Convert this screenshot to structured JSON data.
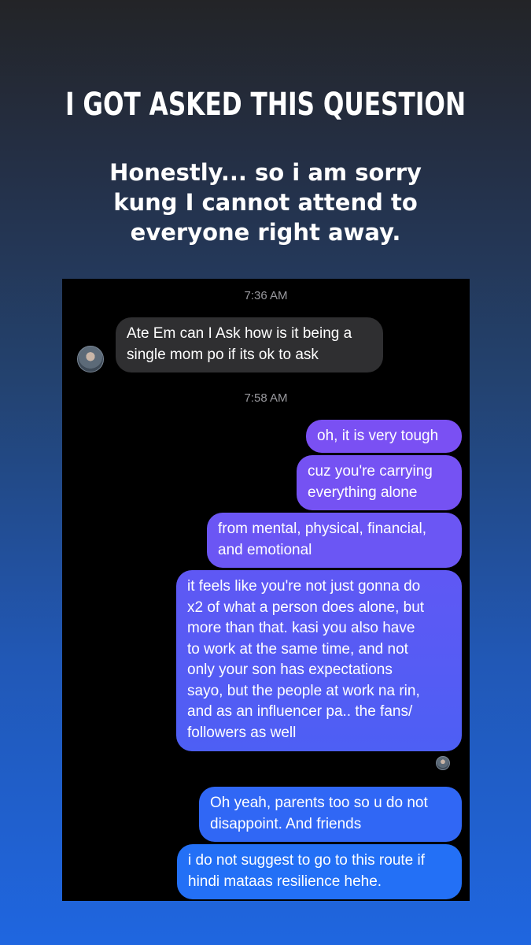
{
  "headline": "I GOT ASKED THIS QUESTION",
  "subtitle": [
    "Honestly... so i am sorry",
    "kung I cannot attend to",
    "everyone right away."
  ],
  "chat": {
    "time1": "7:36 AM",
    "incoming": [
      "Ate Em can I Ask how is it being a",
      "single mom po if its ok to ask"
    ],
    "time2": "7:58 AM",
    "outgoing1": [
      "oh, it is very tough"
    ],
    "outgoing2": [
      "cuz you're carrying",
      "everything alone"
    ],
    "outgoing3": [
      "from mental, physical, financial,",
      "and emotional"
    ],
    "outgoing4": [
      "it feels like you're not just gonna do",
      "x2 of what a person does alone, but",
      "more than that. kasi you also have",
      "to work at the same time, and not",
      "only your son has expectations",
      "sayo, but the people at work na rin,",
      "and as an influencer pa.. the fans/",
      "followers as well"
    ],
    "outgoing5": [
      "Oh yeah, parents too so u do not",
      "disappoint. And friends"
    ],
    "outgoing6": [
      "i do not suggest to go to this route if",
      "hindi mataas resilience hehe."
    ]
  },
  "colors": {
    "incoming_bubble": "#2f2f31",
    "outgoing_top": "#7b4ff2",
    "outgoing_bottom": "#1f6ff5"
  }
}
